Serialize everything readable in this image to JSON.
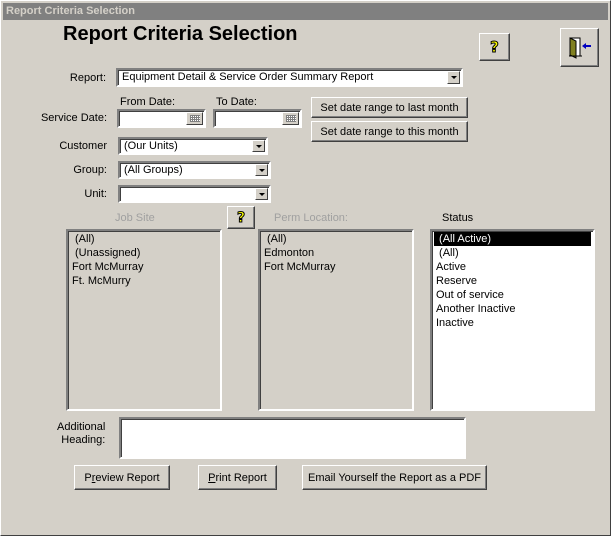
{
  "window": {
    "title": "Report Criteria Selection"
  },
  "header": {
    "title": "Report Criteria Selection",
    "help_icon": "question-mark-icon",
    "exit_icon": "exit-door-icon"
  },
  "form": {
    "report": {
      "label": "Report:",
      "value": "Equipment Detail & Service Order Summary Report"
    },
    "service_date": {
      "label": "Service Date:",
      "from_label": "From Date:",
      "to_label": "To Date:",
      "from_value": "",
      "to_value": ""
    },
    "date_buttons": {
      "last_month": "Set date range  to last month",
      "this_month": "Set date range  to this month"
    },
    "customer": {
      "label": "Customer",
      "value": "(Our Units)"
    },
    "group": {
      "label": "Group:",
      "value": "(All Groups)"
    },
    "unit": {
      "label": "Unit:",
      "value": ""
    }
  },
  "lists": {
    "job_site": {
      "label": "Job Site",
      "items": [
        "(All)",
        "(Unassigned)",
        "Fort McMurray",
        "Ft. McMurry"
      ]
    },
    "perm_location": {
      "label": "Perm Location:",
      "items": [
        "(All)",
        "Edmonton",
        "Fort McMurray"
      ]
    },
    "status": {
      "label": "Status",
      "items": [
        " (All Active)",
        " (All)",
        "Active",
        "Reserve",
        "Out of service",
        "Another Inactive",
        "Inactive"
      ],
      "selected_index": 0
    }
  },
  "additional_heading": {
    "label_line1": "Additional",
    "label_line2": "Heading:",
    "value": ""
  },
  "actions": {
    "preview_p": "P",
    "preview_r": "r",
    "preview_rest": "eview Report",
    "print_p": "P",
    "print_rest": "rint Report",
    "email": "Email Yourself the Report as a PDF"
  }
}
